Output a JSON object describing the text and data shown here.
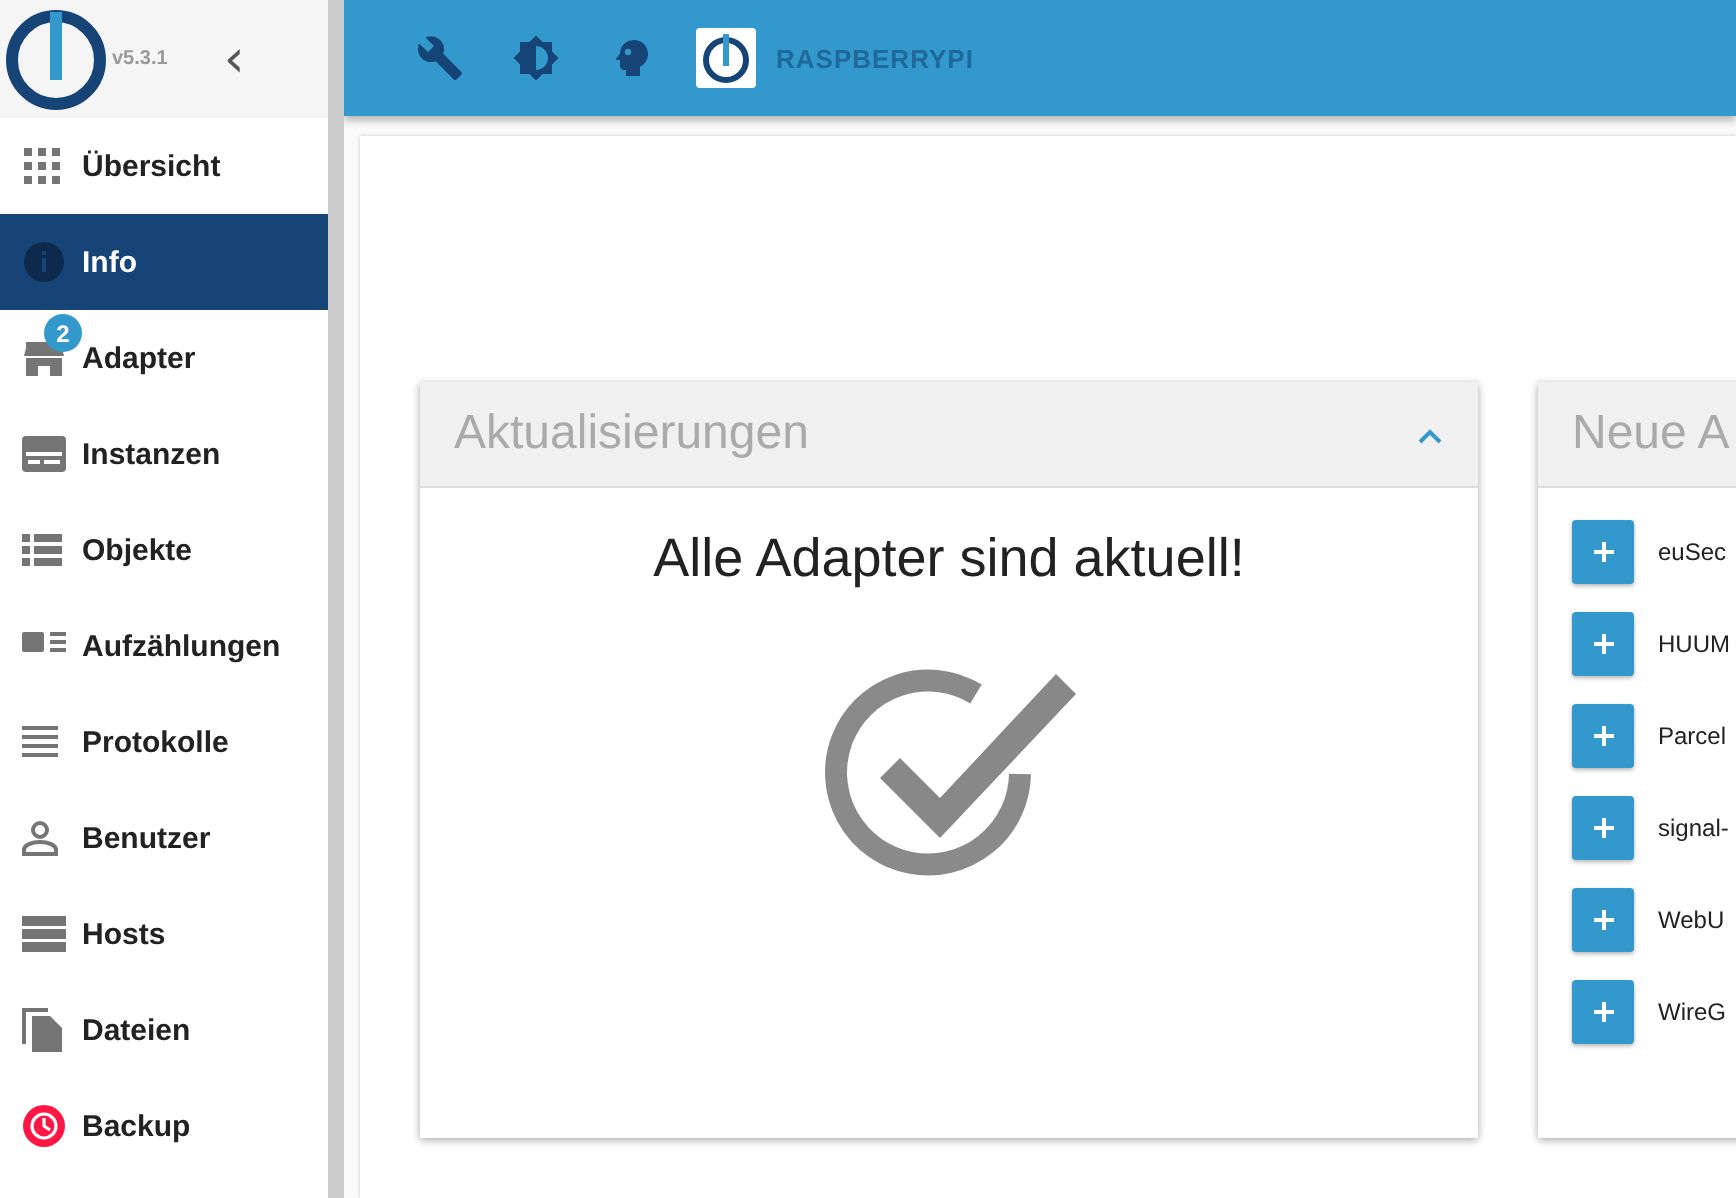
{
  "sidebar": {
    "version": "v5.3.1",
    "collapse_glyph": "‹",
    "items": [
      {
        "label": "Übersicht",
        "kind": "grid",
        "selected": false
      },
      {
        "label": "Info",
        "kind": "info",
        "selected": true
      },
      {
        "label": "Adapter",
        "kind": "store",
        "selected": false,
        "badge": "2"
      },
      {
        "label": "Instanzen",
        "kind": "instances",
        "selected": false
      },
      {
        "label": "Objekte",
        "kind": "list",
        "selected": false
      },
      {
        "label": "Aufzählungen",
        "kind": "enums",
        "selected": false
      },
      {
        "label": "Protokolle",
        "kind": "lines",
        "selected": false
      },
      {
        "label": "Benutzer",
        "kind": "user",
        "selected": false
      },
      {
        "label": "Hosts",
        "kind": "hosts",
        "selected": false
      },
      {
        "label": "Dateien",
        "kind": "files",
        "selected": false
      },
      {
        "label": "Backup",
        "kind": "backup",
        "selected": false
      }
    ]
  },
  "toolbar": {
    "host": "RASPBERRYPI"
  },
  "updates_card": {
    "title": "Aktualisierungen",
    "expanded": true,
    "message": "Alle Adapter sind aktuell!"
  },
  "new_adapters_card": {
    "title": "Neue A",
    "items": [
      "euSec",
      "HUUM",
      "Parcel",
      "signal-",
      "WebU",
      "WireG"
    ]
  }
}
